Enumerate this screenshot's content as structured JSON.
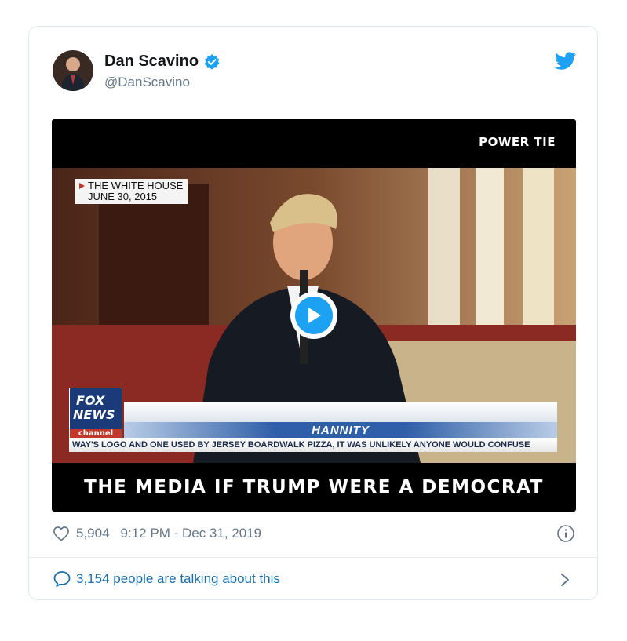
{
  "author": {
    "name": "Dan Scavino",
    "handle": "@DanScavino",
    "verified": true
  },
  "media": {
    "brand_watermark": "POWER TIE",
    "location_caption_line1": "THE WHITE HOUSE",
    "location_caption_line2": "JUNE 30, 2015",
    "network_logo_line1": "FOX",
    "network_logo_line2": "NEWS",
    "network_logo_line3": "channel",
    "show_name": "HANNITY",
    "ticker_text": "WAY'S LOGO AND ONE USED BY JERSEY BOARDWALK PIZZA, IT WAS UNLIKELY ANYONE WOULD CONFUSE",
    "subtitle": "THE MEDIA IF TRUMP WERE A DEMOCRAT"
  },
  "stats": {
    "likes": "5,904",
    "timestamp": "9:12 PM - Dec 31, 2019"
  },
  "footer": {
    "talking_text": "3,154 people are talking about this"
  },
  "colors": {
    "accent": "#1da1f2",
    "link": "#1b6fa8",
    "muted": "#657786"
  }
}
